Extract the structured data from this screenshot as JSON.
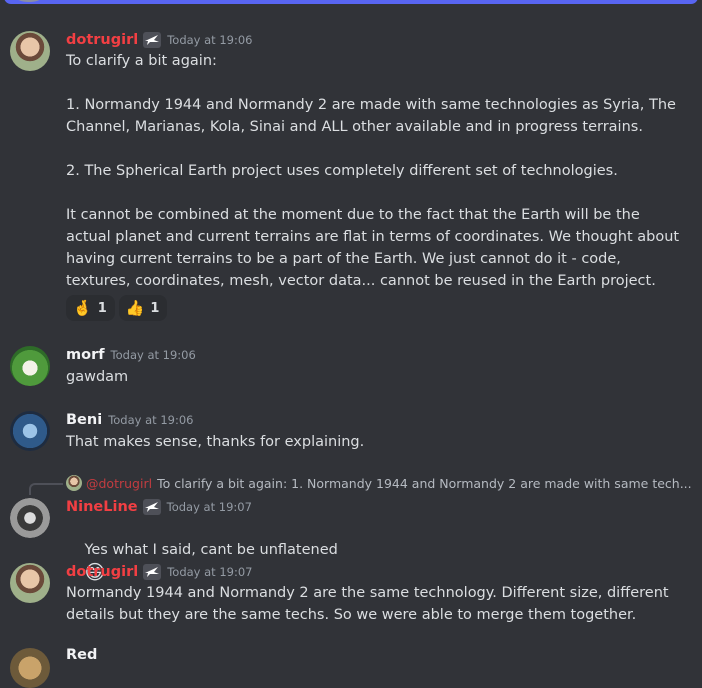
{
  "colors": {
    "accent": "#5865f2",
    "username_red": "#f23f43",
    "background": "#313338"
  },
  "messages": [
    {
      "author": "dotrugirl",
      "timestamp": "Today at 19:06",
      "body": "To clarify a bit again:\n\n1. Normandy 1944 and Normandy 2 are made with same technologies as Syria, The Channel, Marianas, Kola, Sinai and ALL other available and in progress terrains.\n\n2. The Spherical Earth project uses completely different set of technologies.\n\nIt cannot be combined at the moment due to the fact that the Earth will be the actual planet and current terrains are flat in terms of coordinates. We thought about having current terrains to be a part of the Earth. We just cannot do it - code, textures, coordinates, mesh, vector data... cannot be reused in the Earth project.",
      "reactions": [
        {
          "emoji": "🤞",
          "count": "1"
        },
        {
          "emoji": "👍",
          "count": "1"
        }
      ]
    },
    {
      "author": "morf",
      "timestamp": "Today at 19:06",
      "body": "gawdam"
    },
    {
      "author": "Beni",
      "timestamp": "Today at 19:06",
      "body": "That makes sense, thanks for explaining."
    },
    {
      "reply_to": {
        "author": "@dotrugirl",
        "snippet": "To clarify a bit again: 1. Normandy 1944 and Normandy 2 are made with same tech..."
      },
      "author": "NineLine",
      "timestamp": "Today at 19:07",
      "body": "Yes what I said, cant be unflatened",
      "emoji": "😄"
    },
    {
      "author": "dotrugirl",
      "timestamp": "Today at 19:07",
      "body": "Normandy 1944 and Normandy 2 are the same technology. Different size, different details but they are the same techs. So we were able to merge them together."
    },
    {
      "author": "Red"
    }
  ]
}
